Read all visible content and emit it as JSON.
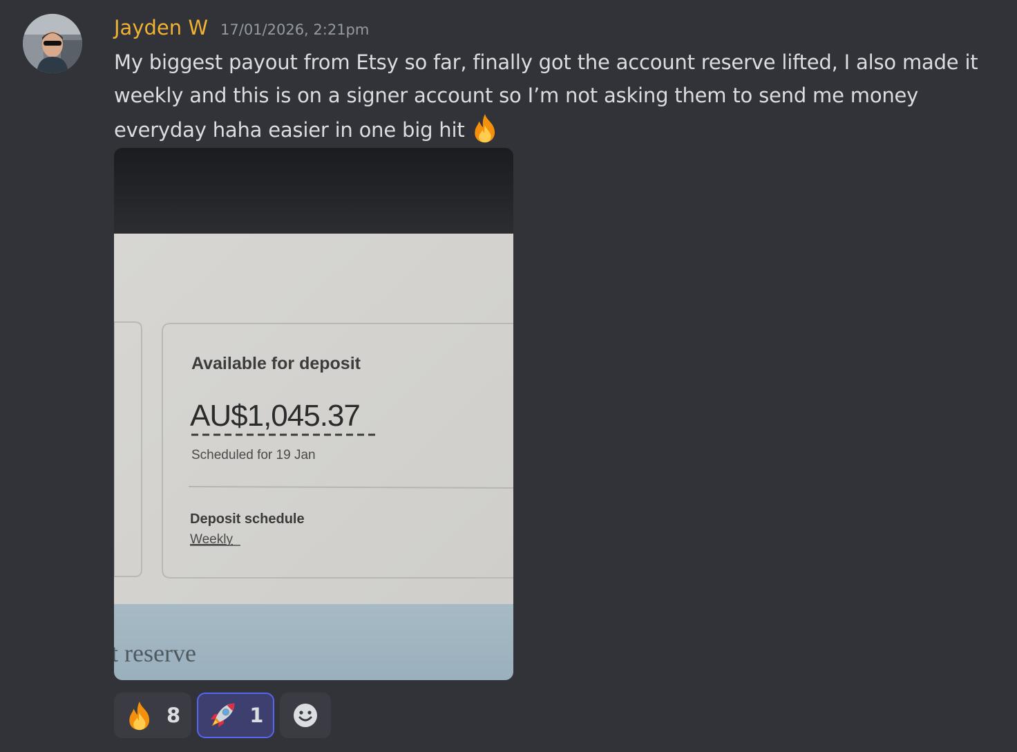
{
  "message": {
    "author": "Jayden W",
    "timestamp": "17/01/2026, 2:21pm",
    "lines": [
      "My biggest payout from Etsy so far, finally got the account reserve lifted, I also made it",
      "weekly and this is on a signer account so I’m not asking them to send me money",
      "everyday haha easier in one big hit"
    ],
    "trailing_emoji": "fire-icon"
  },
  "attachment": {
    "card_title": "Available for deposit",
    "amount": "AU$1,045.37",
    "scheduled": "Scheduled for 19 Jan",
    "schedule_label": "Deposit schedule",
    "schedule_value": "Weekly",
    "footer_text": "t reserve"
  },
  "reactions": [
    {
      "emoji": "fire-icon",
      "count": "8",
      "me": false
    },
    {
      "emoji": "rocket-icon",
      "count": "1",
      "me": true
    }
  ],
  "add_reaction_icon": "smiley-add-icon",
  "colors": {
    "background": "#323339",
    "username": "#f0b232",
    "timestamp": "#949ba4",
    "text": "#dbdee1",
    "reaction_bg": "#3b3c43",
    "reaction_me_border": "#5865f2"
  }
}
